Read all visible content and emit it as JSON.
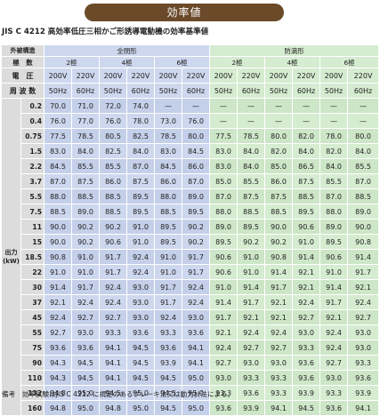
{
  "banner": "効率値",
  "subtitle": "JIS C 4212 高効率低圧三相かご形誘導電動機の効率基準値",
  "header": {
    "outer_structure": "外被構造",
    "enclosed": "全閉形",
    "dripproof": "防滴形",
    "poles_label": "極　数",
    "poles": [
      "2極",
      "4極",
      "6極",
      "2極",
      "4極",
      "6極"
    ],
    "voltage_label": "電　圧",
    "voltages": [
      "200V",
      "220V",
      "200V",
      "220V",
      "200V",
      "220V",
      "200V",
      "220V",
      "200V",
      "220V",
      "200V",
      "220V"
    ],
    "freq_label": "周 波 数",
    "freqs": [
      "50Hz",
      "60Hz",
      "50Hz",
      "60Hz",
      "50Hz",
      "60Hz",
      "50Hz",
      "60Hz",
      "50Hz",
      "60Hz",
      "50Hz",
      "60Hz"
    ],
    "side_label_1": "出力",
    "side_label_2": "(kW)"
  },
  "rows": [
    {
      "kw": "0.2",
      "v": [
        "70.0",
        "71.0",
        "72.0",
        "74.0",
        "—",
        "—",
        "—",
        "—",
        "—",
        "—",
        "—",
        "—"
      ]
    },
    {
      "kw": "0.4",
      "v": [
        "76.0",
        "77.0",
        "76.0",
        "78.0",
        "73.0",
        "76.0",
        "—",
        "—",
        "—",
        "—",
        "—",
        "—"
      ]
    },
    {
      "kw": "0.75",
      "v": [
        "77.5",
        "78.5",
        "80.5",
        "82.5",
        "78.5",
        "80.0",
        "77.5",
        "78.5",
        "80.0",
        "82.0",
        "78.0",
        "80.0"
      ]
    },
    {
      "kw": "1.5",
      "v": [
        "83.0",
        "84.0",
        "82.5",
        "84.0",
        "83.0",
        "84.5",
        "83.0",
        "84.0",
        "82.0",
        "84.0",
        "82.0",
        "84.0"
      ]
    },
    {
      "kw": "2.2",
      "v": [
        "84.5",
        "85.5",
        "85.5",
        "87.0",
        "84.5",
        "86.0",
        "83.0",
        "84.0",
        "85.0",
        "86.5",
        "84.0",
        "85.5"
      ]
    },
    {
      "kw": "3.7",
      "v": [
        "87.0",
        "87.5",
        "86.0",
        "87.5",
        "86.0",
        "87.0",
        "85.0",
        "85.5",
        "86.0",
        "87.5",
        "85.5",
        "87.0"
      ]
    },
    {
      "kw": "5.5",
      "v": [
        "88.0",
        "88.5",
        "88.5",
        "89.5",
        "88.0",
        "89.0",
        "87.0",
        "87.5",
        "87.5",
        "88.5",
        "87.0",
        "88.5"
      ]
    },
    {
      "kw": "7.5",
      "v": [
        "88.5",
        "89.0",
        "88.5",
        "89.5",
        "88.5",
        "89.5",
        "88.0",
        "88.5",
        "88.5",
        "89.5",
        "88.0",
        "89.0"
      ]
    },
    {
      "kw": "11",
      "v": [
        "90.0",
        "90.2",
        "90.2",
        "91.0",
        "89.5",
        "90.2",
        "89.0",
        "89.5",
        "90.0",
        "90.6",
        "89.0",
        "90.0"
      ]
    },
    {
      "kw": "15",
      "v": [
        "90.0",
        "90.2",
        "90.6",
        "91.0",
        "89.5",
        "90.2",
        "89.5",
        "90.2",
        "90.2",
        "91.0",
        "89.5",
        "90.8"
      ]
    },
    {
      "kw": "18.5",
      "v": [
        "90.8",
        "91.0",
        "91.7",
        "92.4",
        "91.0",
        "91.7",
        "90.6",
        "91.0",
        "90.8",
        "91.4",
        "90.6",
        "91.4"
      ]
    },
    {
      "kw": "22",
      "v": [
        "91.0",
        "91.0",
        "91.7",
        "92.4",
        "91.0",
        "91.7",
        "90.6",
        "91.0",
        "91.4",
        "92.1",
        "91.0",
        "91.7"
      ]
    },
    {
      "kw": "30",
      "v": [
        "91.4",
        "91.7",
        "92.4",
        "93.0",
        "91.7",
        "92.4",
        "91.0",
        "91.4",
        "91.7",
        "92.1",
        "91.4",
        "92.1"
      ]
    },
    {
      "kw": "37",
      "v": [
        "92.1",
        "92.4",
        "92.4",
        "93.0",
        "91.7",
        "92.4",
        "91.4",
        "91.7",
        "92.1",
        "92.4",
        "91.7",
        "92.4"
      ]
    },
    {
      "kw": "45",
      "v": [
        "92.4",
        "92.7",
        "92.7",
        "93.0",
        "92.4",
        "93.0",
        "91.7",
        "92.1",
        "92.1",
        "92.7",
        "92.1",
        "92.7"
      ]
    },
    {
      "kw": "55",
      "v": [
        "92.7",
        "93.0",
        "93.3",
        "93.6",
        "93.3",
        "93.6",
        "92.1",
        "92.4",
        "92.4",
        "93.0",
        "92.4",
        "93.0"
      ]
    },
    {
      "kw": "75",
      "v": [
        "93.6",
        "93.6",
        "94.1",
        "94.5",
        "93.6",
        "94.1",
        "92.4",
        "92.7",
        "92.7",
        "93.3",
        "92.4",
        "93.0"
      ]
    },
    {
      "kw": "90",
      "v": [
        "94.3",
        "94.5",
        "94.1",
        "94.5",
        "93.9",
        "94.1",
        "92.7",
        "93.0",
        "93.0",
        "93.6",
        "92.7",
        "93.3"
      ]
    },
    {
      "kw": "110",
      "v": [
        "94.3",
        "94.5",
        "94.1",
        "94.5",
        "94.5",
        "95.0",
        "93.0",
        "93.3",
        "93.3",
        "93.6",
        "93.0",
        "93.6"
      ]
    },
    {
      "kw": "132",
      "v": [
        "94.8",
        "95.0",
        "94.5",
        "95.0",
        "94.5",
        "95.0",
        "93.3",
        "93.6",
        "93.3",
        "93.9",
        "93.3",
        "93.9"
      ]
    },
    {
      "kw": "160",
      "v": [
        "94.8",
        "95.0",
        "94.8",
        "95.0",
        "94.5",
        "95.0",
        "93.6",
        "93.9",
        "94.1",
        "94.5",
        "93.6",
        "94.1"
      ]
    }
  ],
  "note": "備考　効率試験はJIS C 4212 に規定のあるブレーキ法又は動力計法による。"
}
